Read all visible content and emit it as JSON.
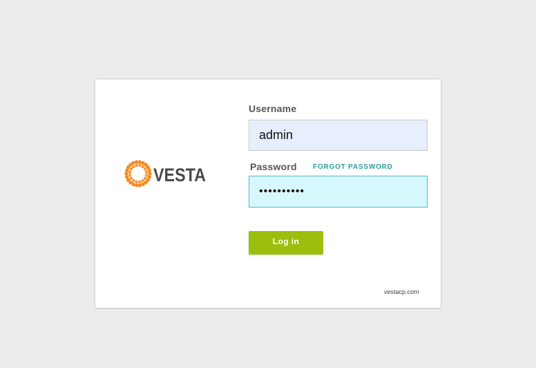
{
  "login": {
    "logo_text": "VESTA",
    "username_label": "Username",
    "username_value": "admin",
    "password_label": "Password",
    "password_value": "••••••••••",
    "forgot_link": "FORGOT PASSWORD",
    "login_button": "Log in",
    "footer_link": "vestacp.com"
  },
  "colors": {
    "background": "#ececec",
    "accent_button": "#9cbf0e",
    "forgot_link": "#2c9c9c",
    "logo_orange": "#f68b1f",
    "logo_text": "#4a4a4a",
    "username_field_bg": "#e8effc",
    "password_field_bg": "#d6f7fb"
  },
  "icons": {
    "logo": "vesta-logo"
  }
}
